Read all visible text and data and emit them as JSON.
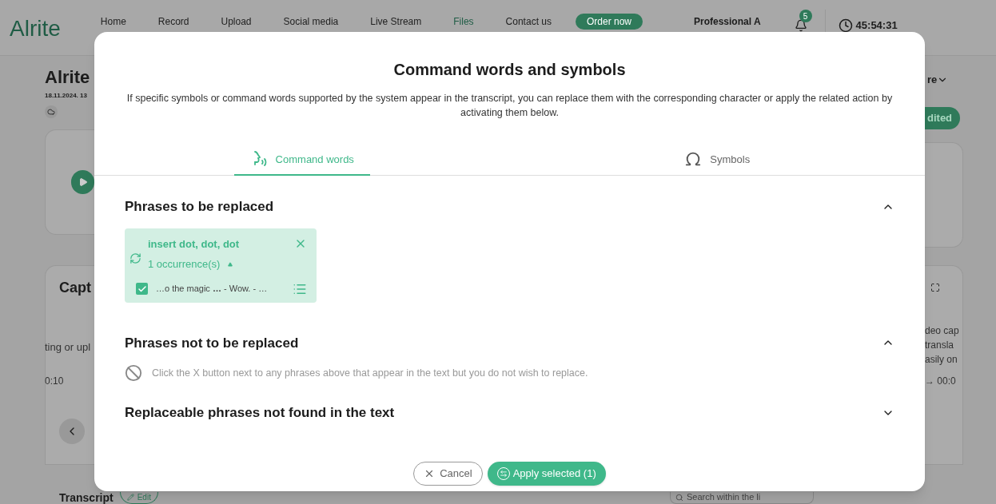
{
  "header": {
    "logo": "Alrite",
    "nav": [
      {
        "label": "Home",
        "selected": false
      },
      {
        "label": "Record",
        "selected": false
      },
      {
        "label": "Upload",
        "selected": false
      },
      {
        "label": "Social media",
        "selected": false
      },
      {
        "label": "Live Stream",
        "selected": false
      },
      {
        "label": "Files",
        "selected": true
      },
      {
        "label": "Contact us",
        "selected": false
      }
    ],
    "order_button": "Order now",
    "user": "Professional A",
    "notification_count": "5",
    "timer": "45:54:31"
  },
  "background": {
    "title": "Alrite",
    "date": "18.11.2024. 13",
    "more_menu": "re",
    "status_badge": "dited",
    "caption_title": "Capt",
    "caption_left_text": "ting or upl",
    "caption_left_time": "0:10",
    "caption_right_lines": [
      "deo cap",
      "transla",
      "asily on"
    ],
    "caption_right_time": "→ 00:0",
    "transcript_title": "Transcript",
    "edit_button": "Edit",
    "search_placeholder": "Search within the li"
  },
  "dialog": {
    "title": "Command words and symbols",
    "description": "If specific symbols or command words supported by the system appear in the transcript, you can replace them with the corresponding character or apply the related action by activating them below.",
    "tabs": [
      {
        "kind": "command",
        "label": "Command words",
        "selected": true
      },
      {
        "kind": "symbols",
        "label": "Symbols",
        "selected": false
      }
    ],
    "sections": [
      {
        "title": "Phrases to be replaced",
        "expanded": true,
        "phrases": [
          {
            "phrase": "insert dot, dot, dot",
            "occurrences": "1 occurrence(s)",
            "expanded": true,
            "matches": [
              {
                "checked": true,
                "text": "…o the magic **…** - Wow. - …"
              }
            ]
          }
        ]
      },
      {
        "title": "Phrases not to be replaced",
        "expanded": true,
        "hint": "Click the X button next to any phrases above that appear in the text but you do not wish to replace."
      },
      {
        "title": "Replaceable phrases not found in the text",
        "expanded": false
      }
    ],
    "cancel_button": "Cancel",
    "apply_button": "Apply selected (1)"
  }
}
